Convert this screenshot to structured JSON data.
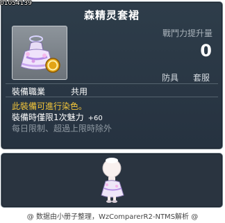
{
  "item_id": "01054139",
  "title": "森精灵套裙",
  "item_icon": "dress-icon",
  "stat": {
    "label": "戰鬥力提升量",
    "value": "0"
  },
  "tags": [
    "防具",
    "套服"
  ],
  "job": {
    "label": "裝備職業",
    "value": "共用"
  },
  "descriptions": {
    "dye": "此裝備可進行染色。",
    "charm_text": "裝備時僅限1次魅力",
    "charm_bonus": "+60",
    "limit": "每日限制、超過上限時除外"
  },
  "preview_avatar": "avatar-preview",
  "footer": "@ 数据由小册子整理，WzComparerR2-NTMS解析 @",
  "colors": {
    "panel_bg": "#2a3440",
    "panel_border": "#6f7c87",
    "dye_text": "#f4c73a",
    "muted_text": "#8e98a1"
  }
}
